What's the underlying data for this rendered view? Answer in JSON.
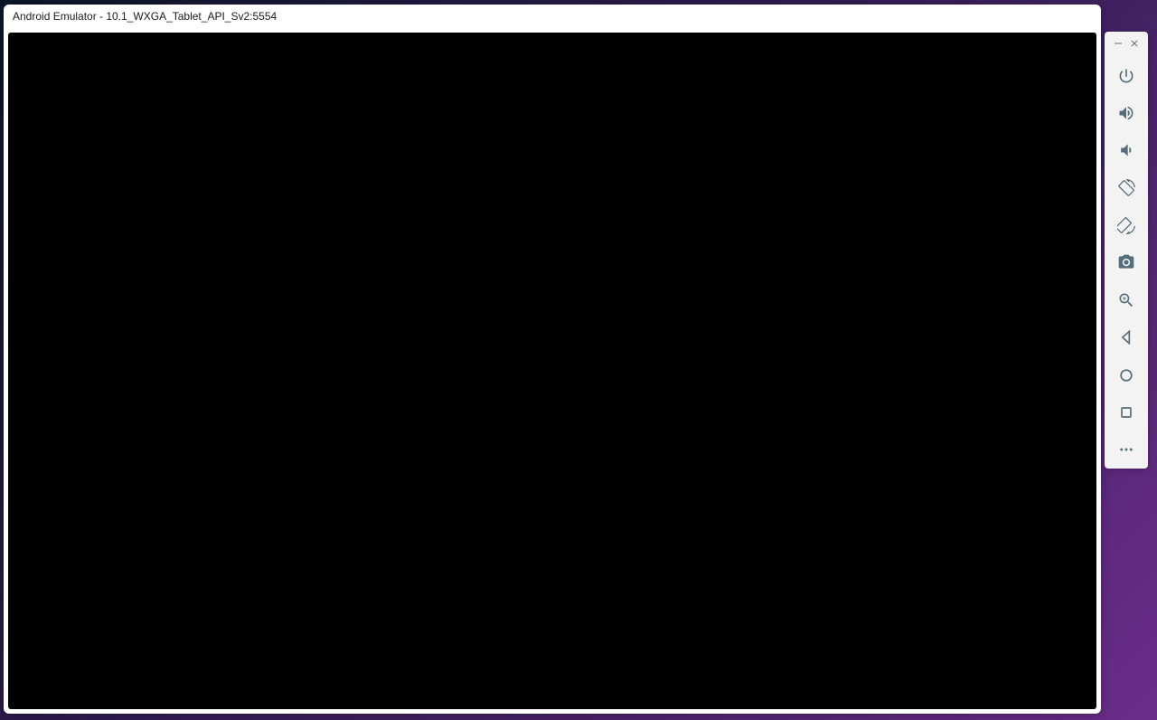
{
  "window": {
    "title": "Android Emulator - 10.1_WXGA_Tablet_API_Sv2:5554"
  },
  "toolbar": {
    "minimize_label": "Minimize",
    "close_label": "Close",
    "power_label": "Power",
    "volume_up_label": "Volume Up",
    "volume_down_label": "Volume Down",
    "rotate_left_label": "Rotate Left",
    "rotate_right_label": "Rotate Right",
    "screenshot_label": "Take Screenshot",
    "zoom_label": "Zoom",
    "back_label": "Back",
    "home_label": "Home",
    "overview_label": "Overview",
    "more_label": "More"
  },
  "colors": {
    "toolbar_icon": "#546e7a",
    "toolbar_bg": "#f3f3f3",
    "screen_bg": "#000000"
  }
}
